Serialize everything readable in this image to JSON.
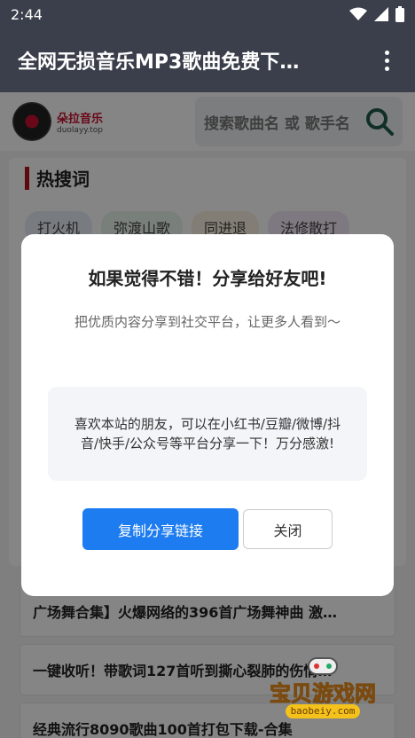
{
  "status_bar": {
    "time": "2:44"
  },
  "app_bar": {
    "title": "全网无损音乐MP3歌曲免费下…"
  },
  "site": {
    "logo_name": "朵拉音乐",
    "logo_url": "duolayy.top",
    "search_placeholder": "搜索歌曲名 或 歌手名"
  },
  "hot": {
    "title": "热搜词",
    "tags": [
      {
        "label": "打火机",
        "color": "#e6eef7"
      },
      {
        "label": "弥渡山歌",
        "color": "#e8f3ea"
      },
      {
        "label": "同进退",
        "color": "#fbf1e0"
      },
      {
        "label": "法修散打",
        "color": "#f2e9f5"
      }
    ]
  },
  "list": {
    "items": [
      "广场舞合集】火爆网络的396首广场舞神曲 激…",
      "一键收听！带歌词127首听到撕心裂肺的伤情…",
      "经典流行8090歌曲100首打包下载-合集"
    ]
  },
  "dialog": {
    "title": "如果觉得不错！分享给好友吧!",
    "subtitle": "把优质内容分享到社交平台，让更多人看到～",
    "note": "喜欢本站的朋友，可以在小红书/豆瓣/微博/抖音/快手/公众号等平台分享一下！万分感激!",
    "copy_label": "复制分享链接",
    "close_label": "关闭"
  },
  "watermark": {
    "text": "宝贝游戏网",
    "url": "baobeiy.com"
  },
  "colors": {
    "app_bar": "#3a3f4b",
    "accent_blue": "#1d7cf0",
    "hot_mark": "#b5121b"
  }
}
